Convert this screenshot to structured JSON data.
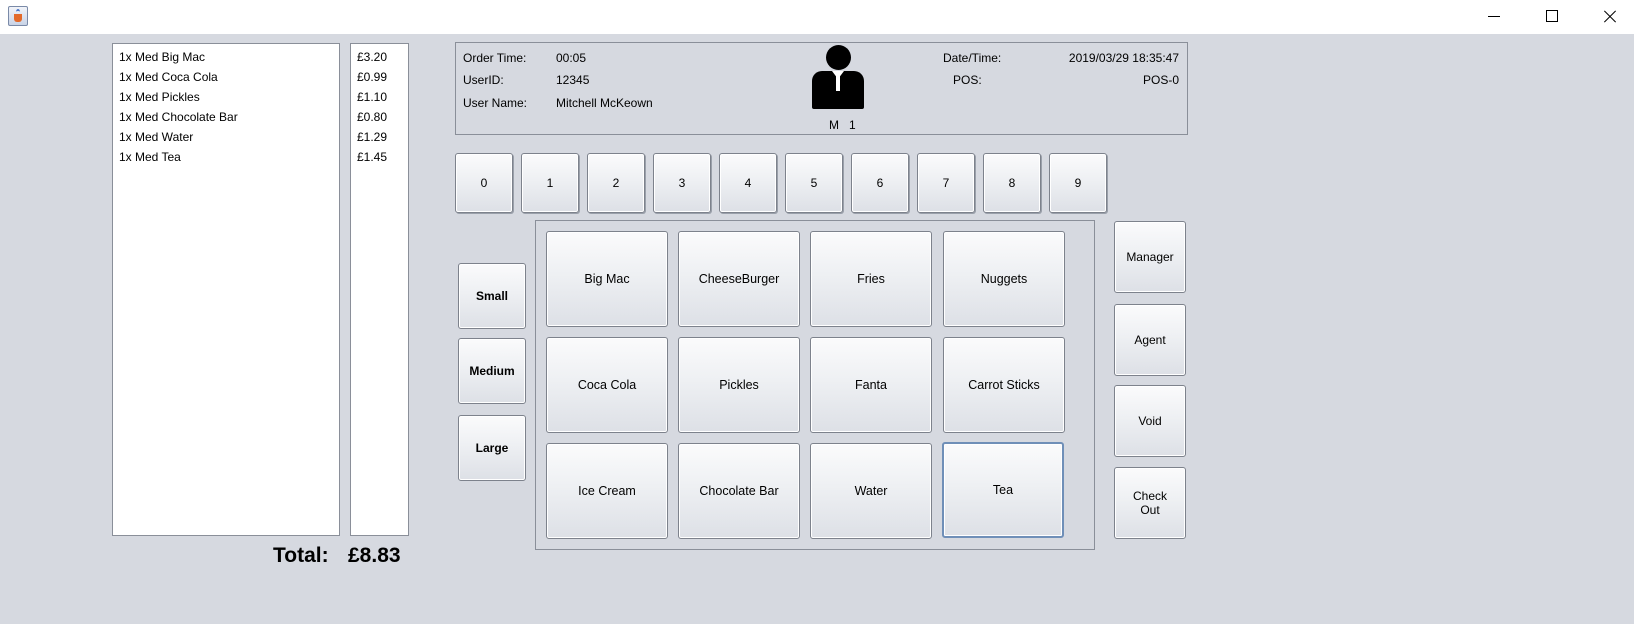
{
  "window": {
    "minimize": "",
    "maximize": "",
    "close": ""
  },
  "order": {
    "items": [
      {
        "name": "1x Med Big Mac",
        "price": "£3.20"
      },
      {
        "name": "1x Med Coca Cola",
        "price": "£0.99"
      },
      {
        "name": "1x Med Pickles",
        "price": "£1.10"
      },
      {
        "name": "1x Med Chocolate Bar",
        "price": "£0.80"
      },
      {
        "name": "1x Med Water",
        "price": "£1.29"
      },
      {
        "name": "1x Med Tea",
        "price": "£1.45"
      }
    ],
    "total_label": "Total:",
    "total_value": "£8.83"
  },
  "info": {
    "order_time_label": "Order Time:",
    "order_time": "00:05",
    "user_id_label": "UserID:",
    "user_id": "12345",
    "user_name_label": "User Name:",
    "user_name": "Mitchell McKeown",
    "avatar_caption": "M   1",
    "datetime_label": "Date/Time:",
    "datetime": "2019/03/29 18:35:47",
    "pos_label": "POS:",
    "pos": "POS-0"
  },
  "numpad": [
    "0",
    "1",
    "2",
    "3",
    "4",
    "5",
    "6",
    "7",
    "8",
    "9"
  ],
  "sizes": [
    "Small",
    "Medium",
    "Large"
  ],
  "menu_items": [
    "Big Mac",
    "CheeseBurger",
    "Fries",
    "Nuggets",
    "Coca Cola",
    "Pickles",
    "Fanta",
    "Carrot Sticks",
    "Ice Cream",
    "Chocolate Bar",
    "Water",
    "Tea"
  ],
  "actions": {
    "manager": "Manager",
    "agent": "Agent",
    "void": "Void",
    "checkout": "Check Out"
  }
}
